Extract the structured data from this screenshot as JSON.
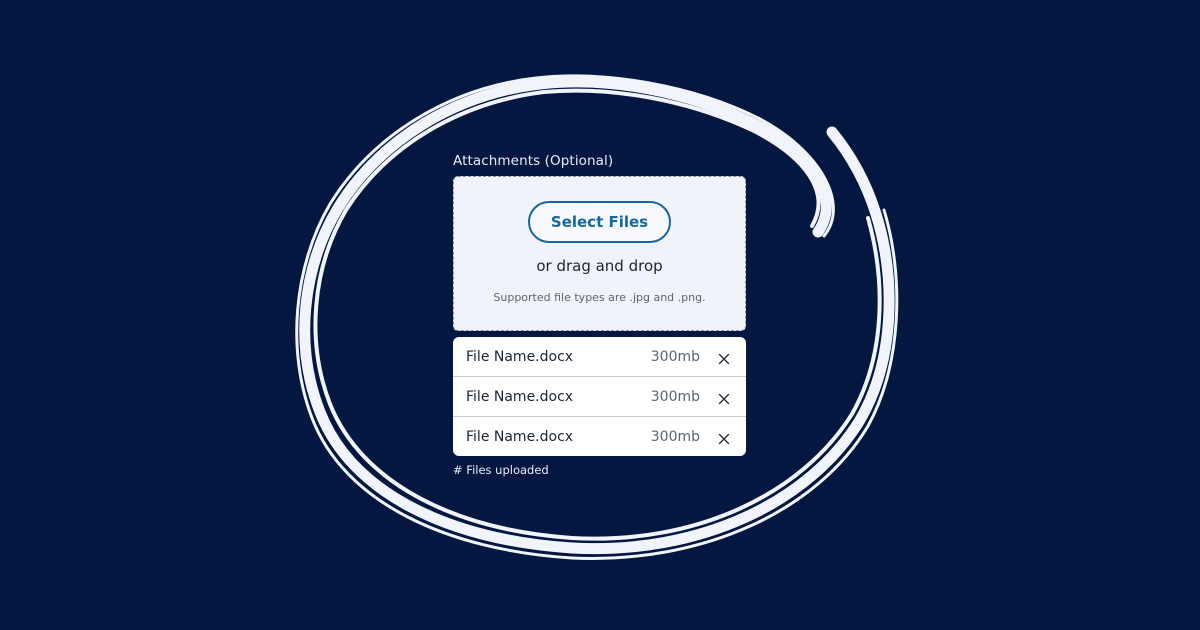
{
  "background_color": "#031741",
  "accent_color": "#17679b",
  "upload": {
    "label": "Attachments (Optional)",
    "select_button_label": "Select Files",
    "drag_text": "or drag and drop",
    "supported_text": "Supported file types are .jpg and .png."
  },
  "files": [
    {
      "name": "File Name.docx",
      "size": "300mb",
      "remove_icon": "close-icon"
    },
    {
      "name": "File Name.docx",
      "size": "300mb",
      "remove_icon": "close-icon"
    },
    {
      "name": "File Name.docx",
      "size": "300mb",
      "remove_icon": "close-icon"
    }
  ],
  "footer": {
    "uploaded_text": "# Files uploaded"
  }
}
